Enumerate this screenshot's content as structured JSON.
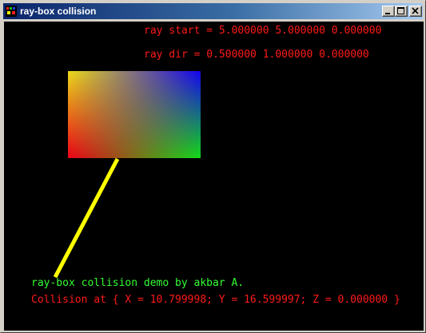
{
  "window": {
    "title": "ray-box collision"
  },
  "titlebar_buttons": {
    "minimize": "minimize",
    "maximize": "maximize",
    "close": "close"
  },
  "overlay": {
    "ray_start": "ray start = 5.000000 5.000000 0.000000",
    "ray_dir": "ray dir = 0.500000 1.000000 0.000000",
    "credit": "ray-box collision demo by akbar A.",
    "collision": "Collision at { X = 10.799998; Y = 16.599997; Z = 0.000000 }"
  },
  "colors": {
    "text_red": "#ff1a1a",
    "text_green": "#33ff33",
    "ray_yellow": "#ffff00",
    "corner_top_left": "#ffff00",
    "corner_top_right": "#0000ff",
    "corner_bottom_left": "#ff0000",
    "corner_bottom_right": "#00ff00"
  }
}
